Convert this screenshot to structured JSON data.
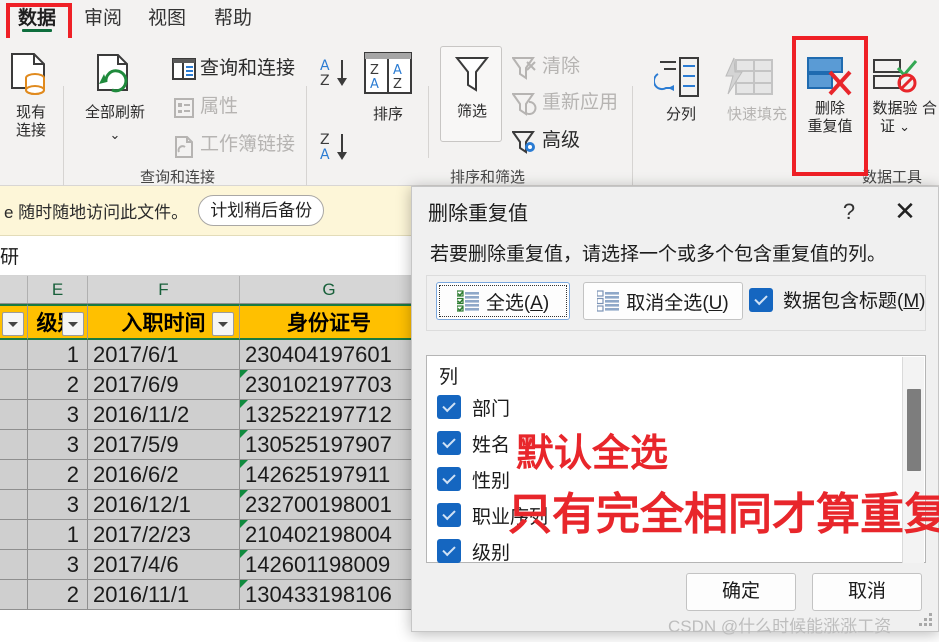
{
  "ribbon": {
    "tabs": [
      {
        "label": "数据",
        "active": true
      },
      {
        "label": "审阅",
        "active": false
      },
      {
        "label": "视图",
        "active": false
      },
      {
        "label": "帮助",
        "active": false
      }
    ],
    "groups": [
      {
        "label": "查询和连接"
      },
      {
        "label": "排序和筛选"
      },
      {
        "label": "数据工具"
      }
    ],
    "buttons": {
      "existing_connection": "现有\n连接",
      "existing_connection_l1": "现有",
      "existing_connection_l2": "连接",
      "refresh_all": "全部刷新",
      "queries_connections": "查询和连接",
      "properties": "属性",
      "workbook_links": "工作簿链接",
      "sort_az": "A→Z 升序",
      "sort_za": "Z→A 降序",
      "sort": "排序",
      "filter": "筛选",
      "clear": "清除",
      "reapply": "重新应用",
      "advanced": "高级",
      "text_to_columns": "分列",
      "flash_fill": "快速填充",
      "remove_duplicates_l1": "删除",
      "remove_duplicates_l2": "重复值",
      "data_validation_l1": "数据验",
      "data_validation_l2": "证",
      "consolidate_partial": "合"
    }
  },
  "message_bar": {
    "text": "e 随时随地访问此文件。",
    "button": "计划稍后备份"
  },
  "formula_bar": {
    "value": "研"
  },
  "sheet": {
    "column_letters": [
      "E",
      "F",
      "G"
    ],
    "headers": [
      "级别",
      "入职时间",
      "身份证号"
    ],
    "rows": [
      {
        "level": "1",
        "hire_date": "2017/6/1",
        "id_number": "230404197601",
        "flag": false
      },
      {
        "level": "2",
        "hire_date": "2017/6/9",
        "id_number": "230102197703",
        "flag": true
      },
      {
        "level": "3",
        "hire_date": "2016/11/2",
        "id_number": "132522197712",
        "flag": true
      },
      {
        "level": "3",
        "hire_date": "2017/5/9",
        "id_number": "130525197907",
        "flag": true
      },
      {
        "level": "2",
        "hire_date": "2016/6/2",
        "id_number": "142625197911",
        "flag": true
      },
      {
        "level": "3",
        "hire_date": "2016/12/1",
        "id_number": "232700198001",
        "flag": true
      },
      {
        "level": "1",
        "hire_date": "2017/2/23",
        "id_number": "210402198004",
        "flag": true
      },
      {
        "level": "3",
        "hire_date": "2017/4/6",
        "id_number": "142601198009",
        "flag": true
      },
      {
        "level": "2",
        "hire_date": "2016/11/1",
        "id_number": "130433198106",
        "flag": true
      }
    ]
  },
  "dialog": {
    "title": "删除重复值",
    "help_glyph": "?",
    "close_glyph": "✕",
    "instruction": "若要删除重复值，请选择一个或多个包含重复值的列。",
    "select_all": "全选(A)",
    "select_all_plain": "全选",
    "select_all_key": "A",
    "unselect_all_plain": "取消全选",
    "unselect_all_key": "U",
    "has_headers_plain": "数据包含标题",
    "has_headers_key": "M",
    "has_headers_checked": true,
    "list_column_header": "列",
    "columns": [
      {
        "label": "部门",
        "checked": true
      },
      {
        "label": "姓名",
        "checked": true
      },
      {
        "label": "性别",
        "checked": true
      },
      {
        "label": "职业序列",
        "checked": true
      },
      {
        "label": "级别",
        "checked": true
      }
    ],
    "ok": "确定",
    "cancel": "取消"
  },
  "annotations": {
    "line1": "默认全选",
    "line2": "只有完全相同才算重复"
  },
  "watermark": "CSDN @什么时候能涨涨工资",
  "colors": {
    "accent_green": "#0e6e3d",
    "annotation_red": "#e8262b",
    "highlight_box_red": "#ef2026",
    "header_yellow": "#ffc000",
    "checkbox_blue": "#1566c0",
    "message_bar_yellow": "#fdf6d8"
  }
}
